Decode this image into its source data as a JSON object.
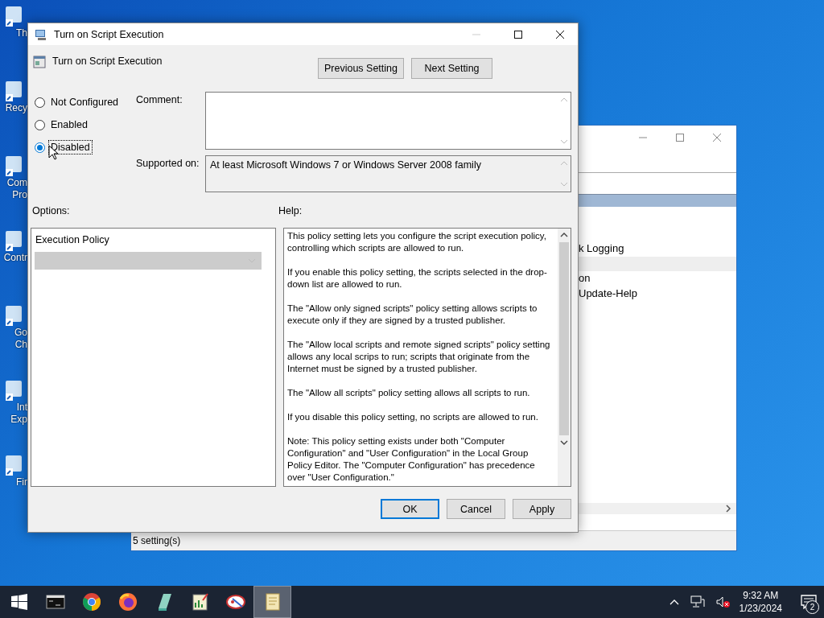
{
  "desktop_icons": [
    {
      "lines": [
        "Th"
      ]
    },
    {
      "lines": [
        "Recy"
      ]
    },
    {
      "lines": [
        "Com",
        "Pro"
      ]
    },
    {
      "lines": [
        "Contr"
      ]
    },
    {
      "lines": [
        "Go",
        "Ch"
      ]
    },
    {
      "lines": [
        "Int",
        "Exp"
      ]
    },
    {
      "lines": [
        "Fir"
      ]
    }
  ],
  "background_window": {
    "items": [
      "k Logging",
      "on",
      "Update-Help"
    ],
    "status": "5 setting(s)"
  },
  "dialog": {
    "title": "Turn on Script Execution",
    "policy_name": "Turn on Script Execution",
    "nav_buttons": [
      "Previous Setting",
      "Next Setting"
    ],
    "states": [
      {
        "label": "Not Configured",
        "selected": false,
        "focused": false
      },
      {
        "label": "Enabled",
        "selected": false,
        "focused": false
      },
      {
        "label": "Disabled",
        "selected": true,
        "focused": true
      }
    ],
    "comment_label": "Comment:",
    "supported_label": "Supported on:",
    "supported_text": "At least Microsoft Windows 7 or Windows Server 2008 family",
    "options_label": "Options:",
    "help_label": "Help:",
    "options": {
      "label": "Execution Policy",
      "dropdown": {
        "disabled": true
      }
    },
    "help": [
      "This policy setting lets you configure the script execution policy, controlling which scripts are allowed to run.",
      "If you enable this policy setting, the scripts selected in the drop-down list are allowed to run.",
      "The \"Allow only signed scripts\" policy setting allows scripts to execute only if they are signed by a trusted publisher.",
      "The \"Allow local scripts and remote signed scripts\" policy setting allows any local scrips to run; scripts that originate from the Internet must be signed by a trusted publisher.",
      "The \"Allow all scripts\" policy setting allows all scripts to run.",
      "If you disable this policy setting, no scripts are allowed to run.",
      "Note: This policy setting exists under both \"Computer Configuration\" and \"User Configuration\" in the Local Group Policy Editor. The \"Computer Configuration\" has precedence over \"User Configuration.\""
    ],
    "buttons": [
      {
        "label": "OK",
        "default": true
      },
      {
        "label": "Cancel",
        "default": false
      },
      {
        "label": "Apply",
        "default": false
      }
    ]
  },
  "taskbar": {
    "apps": [
      {
        "kind": "terminal",
        "active": false
      },
      {
        "kind": "chrome",
        "active": false
      },
      {
        "kind": "firefox",
        "active": false
      },
      {
        "kind": "tool",
        "active": false
      },
      {
        "kind": "chart",
        "active": false
      },
      {
        "kind": "paint",
        "active": false
      },
      {
        "kind": "scroll",
        "active": true
      }
    ],
    "time": "9:32 AM",
    "date": "1/23/2024",
    "notifications": "2"
  }
}
